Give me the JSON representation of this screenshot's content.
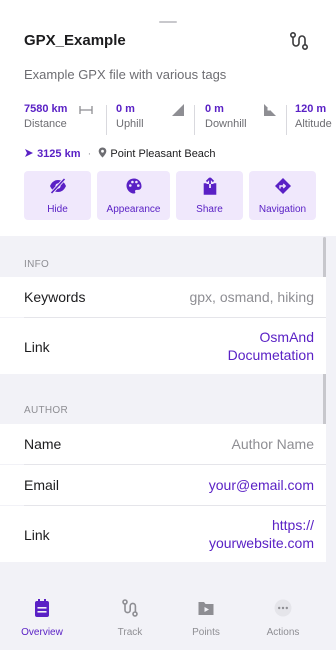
{
  "header": {
    "title": "GPX_Example",
    "description": "Example GPX file with various tags"
  },
  "stats": [
    {
      "value": "7580 km",
      "label": "Distance"
    },
    {
      "value": "0 m",
      "label": "Uphill"
    },
    {
      "value": "0 m",
      "label": "Downhill"
    },
    {
      "value": "120 m",
      "label": "Altitude"
    }
  ],
  "location": {
    "distance": "3125 km",
    "separator": "·",
    "place": "Point Pleasant Beach"
  },
  "actions": [
    {
      "label": "Hide",
      "icon": "eye-off-icon"
    },
    {
      "label": "Appearance",
      "icon": "palette-icon"
    },
    {
      "label": "Share",
      "icon": "share-icon"
    },
    {
      "label": "Navigation",
      "icon": "navigation-icon"
    }
  ],
  "info": {
    "header": "INFO",
    "rows": [
      {
        "key": "Keywords",
        "value": "gpx, osmand, hiking"
      },
      {
        "key": "Link",
        "value_line1": "OsmAnd",
        "value_line2": "Documetation"
      }
    ]
  },
  "author": {
    "header": "AUTHOR",
    "rows": [
      {
        "key": "Name",
        "value": "Author Name"
      },
      {
        "key": "Email",
        "value": "your@email.com"
      },
      {
        "key": "Link",
        "value_line1": "https://",
        "value_line2": "yourwebsite.com"
      }
    ]
  },
  "tabs": [
    {
      "label": "Overview",
      "icon": "overview-icon",
      "active": true
    },
    {
      "label": "Track",
      "icon": "track-icon",
      "active": false
    },
    {
      "label": "Points",
      "icon": "points-icon",
      "active": false
    },
    {
      "label": "Actions",
      "icon": "more-icon",
      "active": false
    }
  ],
  "colors": {
    "accent": "#5a21c5",
    "accent_bg": "#f0e8fc",
    "grouped_bg": "#f2f2f7"
  }
}
